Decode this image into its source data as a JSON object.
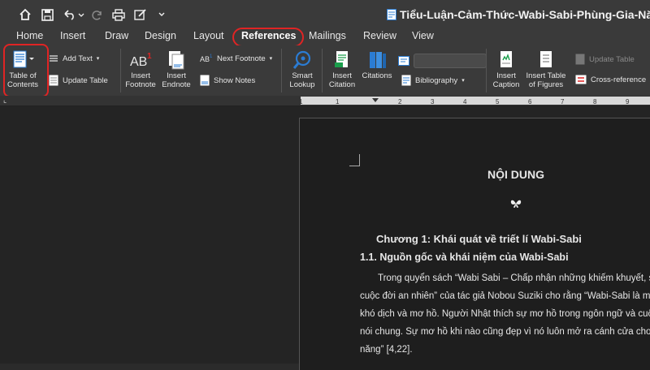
{
  "window": {
    "title": "Tiểu-Luận-Cảm-Thức-Wabi-Sabi-Phùng-Gia-Năng"
  },
  "tabs": [
    {
      "label": "Home"
    },
    {
      "label": "Insert"
    },
    {
      "label": "Draw"
    },
    {
      "label": "Design"
    },
    {
      "label": "Layout"
    },
    {
      "label": "References"
    },
    {
      "label": "Mailings"
    },
    {
      "label": "Review"
    },
    {
      "label": "View"
    }
  ],
  "ribbon": {
    "toc": {
      "line1": "Table of",
      "line2": "Contents"
    },
    "add_text": "Add Text",
    "update_table": "Update Table",
    "insert_footnote": {
      "line1": "Insert",
      "line2": "Footnote"
    },
    "insert_endnote": {
      "line1": "Insert",
      "line2": "Endnote"
    },
    "next_footnote": "Next Footnote",
    "show_notes": "Show Notes",
    "smart_lookup": {
      "line1": "Smart",
      "line2": "Lookup"
    },
    "insert_citation": {
      "line1": "Insert",
      "line2": "Citation"
    },
    "citations": "Citations",
    "bibliography": "Bibliography",
    "insert_caption": {
      "line1": "Insert",
      "line2": "Caption"
    },
    "insert_table_figures": {
      "line1": "Insert Table",
      "line2": "of Figures"
    },
    "update_table_disabled": "Update Table",
    "cross_reference": "Cross-reference"
  },
  "document": {
    "heading": "NỘI DUNG",
    "chapter": "Chương 1: Khái quát về triết lí Wabi-Sabi",
    "section": "1.1.    Nguồn gốc và khái niệm của Wabi-Sabi",
    "paragraph_lines": [
      "Trong quyển sách “Wabi Sabi – Chấp nhận những khiếm khuyết, s",
      "cuộc đời an nhiên” của tác giả Nobou Suziki cho rằng “Wabi-Sabi là mộ",
      "khó dịch và mơ hồ. Người Nhật thích sự mơ hồ trong ngôn ngữ và cuộc s",
      "nói chung. Sự mơ hồ khi nào cũng đẹp vì nó luôn mở ra cánh cửa cho các",
      "năng” [4,22]."
    ]
  },
  "colors": {
    "highlight": "#e02424",
    "doc_icon": "#2b7cd3"
  }
}
